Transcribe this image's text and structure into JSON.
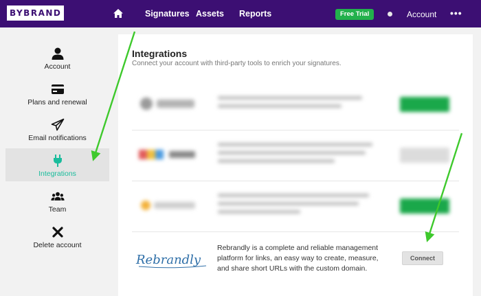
{
  "brand": {
    "logo": "BYBRAND"
  },
  "nav": {
    "items": [
      {
        "label": "Signatures"
      },
      {
        "label": "Assets"
      },
      {
        "label": "Reports"
      }
    ],
    "trial_badge": "Free Trial",
    "account_label": "Account",
    "more_label": "•••"
  },
  "sidebar": {
    "items": [
      {
        "label": "Account",
        "icon": "user-icon"
      },
      {
        "label": "Plans and renewal",
        "icon": "credit-card-icon"
      },
      {
        "label": "Email notifications",
        "icon": "paper-plane-icon"
      },
      {
        "label": "Integrations",
        "icon": "plug-icon",
        "active": true
      },
      {
        "label": "Team",
        "icon": "team-icon"
      },
      {
        "label": "Delete account",
        "icon": "close-icon"
      }
    ]
  },
  "integrations": {
    "title": "Integrations",
    "subtitle": "Connect your account with third-party tools to enrich your signatures.",
    "featured": {
      "name": "Rebrandly",
      "description": "Rebrandly is a complete and reliable management platform for links, an easy way to create, measure, and share short URLs with the custom domain.",
      "button_label": "Connect"
    }
  },
  "colors": {
    "nav_bg": "#3c0f73",
    "accent": "#1abc9c",
    "trial": "#22b14c",
    "annotation_arrow": "#3ec92c"
  }
}
